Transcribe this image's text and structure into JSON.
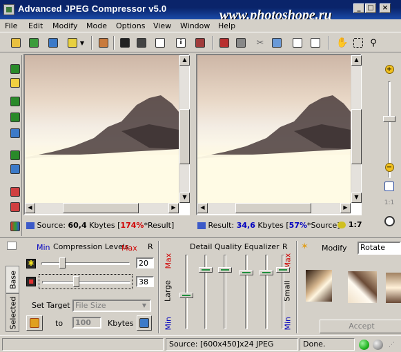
{
  "window": {
    "title": "Advanced JPEG Compressor v5.0",
    "watermark": "www.photoshope.ru",
    "controls": {
      "minimize": "_",
      "maximize": "□",
      "close": "×"
    }
  },
  "menu": [
    "File",
    "Edit",
    "Modify",
    "Mode",
    "Options",
    "View",
    "Window",
    "Help"
  ],
  "toolbar_icons": [
    "open-icon",
    "save-icon",
    "batch-icon",
    "dropdown-arrow-icon",
    "convert-icon",
    "save-floppy-icon",
    "save-as-icon",
    "screen-icon",
    "info-icon",
    "book-icon",
    "copy-icon",
    "paste-icon",
    "cut-icon",
    "crop-icon",
    "compare-icon",
    "page-icon",
    "hand-icon",
    "select-icon",
    "zoom-select-icon"
  ],
  "left_panel": {
    "source": {
      "label": "Source:",
      "size": "60,4",
      "unit": "Kbytes",
      "percent": "174%",
      "ref": "*Result]"
    },
    "result": {
      "label": "Result:",
      "size": "34,6",
      "unit": "Kbytes",
      "percent": "57%",
      "ref": "*Source]",
      "ratio": "1:7"
    }
  },
  "bottom": {
    "tabs": {
      "base": "Base",
      "selected": "Selected"
    },
    "compression": {
      "title": "Compression Levels",
      "min": "Min",
      "max": "Max",
      "r": "R",
      "level1": "20",
      "level2": "38",
      "level1_fraction": 0.22,
      "level2_fraction": 0.38
    },
    "target": {
      "label": "Set Target",
      "select": "File Size",
      "to": "to",
      "value": "100",
      "unit": "Kbytes"
    },
    "equalizer": {
      "title": "Detail Quality Equalizer",
      "r": "R",
      "max": "Max",
      "min": "Min",
      "large": "Large",
      "small": "Small",
      "levels": [
        0.45,
        0.82,
        0.82,
        0.78,
        0.78,
        0.82
      ]
    },
    "modify": {
      "label": "Modify",
      "select": "Rotate",
      "accept": "Accept"
    }
  },
  "statusbar": {
    "source": "Source: [600x450]x24 JPEG",
    "state": "Done."
  },
  "colors": {
    "accent_red": "#d00000",
    "accent_blue": "#0000c0",
    "green_led": "#22b522"
  }
}
